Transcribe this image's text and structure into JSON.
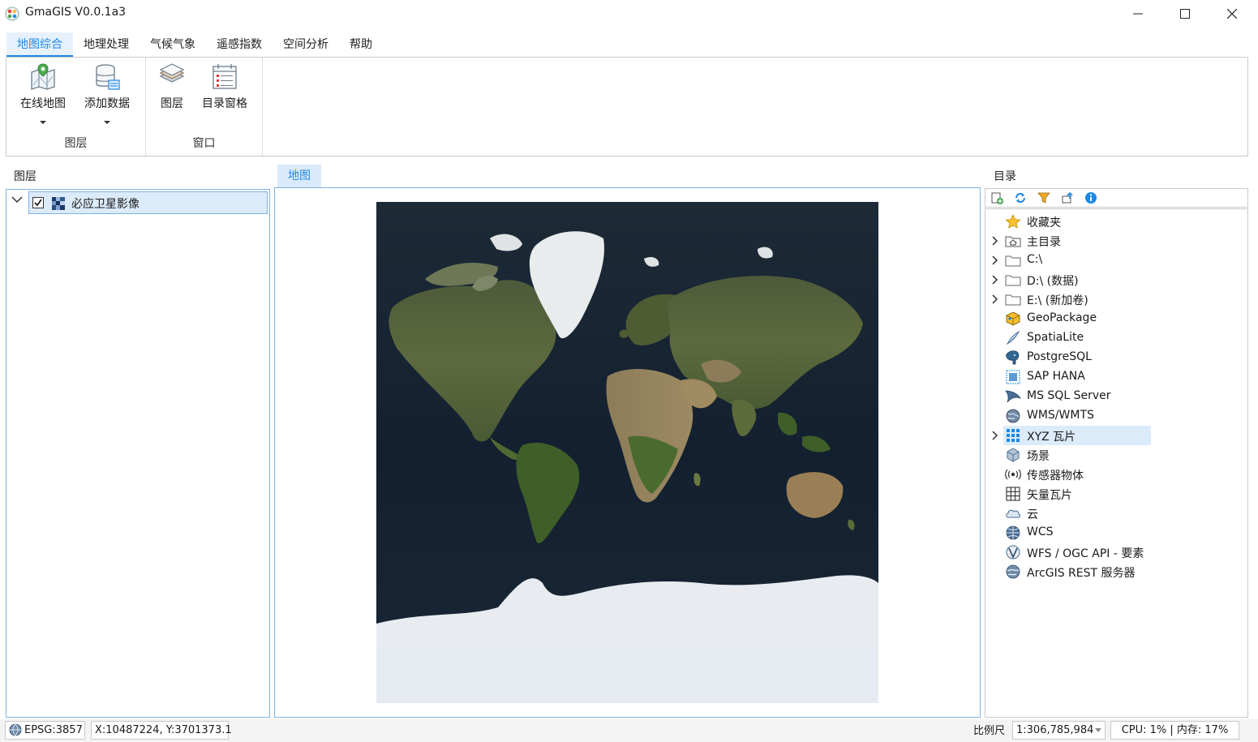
{
  "window": {
    "title": "GmaGIS V0.0.1a3",
    "controls": {
      "minimize": "minimize",
      "maximize": "maximize",
      "close": "close"
    }
  },
  "ribbon": {
    "tabs": [
      {
        "label": "地图综合",
        "active": true
      },
      {
        "label": "地理处理",
        "active": false
      },
      {
        "label": "气候气象",
        "active": false
      },
      {
        "label": "遥感指数",
        "active": false
      },
      {
        "label": "空间分析",
        "active": false
      },
      {
        "label": "帮助",
        "active": false
      }
    ],
    "groups": [
      {
        "label": "图层",
        "buttons": [
          {
            "label": "在线地图",
            "icon": "online-map-icon",
            "dropdown": true
          },
          {
            "label": "添加数据",
            "icon": "add-data-icon",
            "dropdown": true
          }
        ]
      },
      {
        "label": "窗口",
        "buttons": [
          {
            "label": "图层",
            "icon": "layers-icon",
            "dropdown": false
          },
          {
            "label": "目录窗格",
            "icon": "catalog-pane-icon",
            "dropdown": false
          }
        ]
      }
    ]
  },
  "layers_panel": {
    "title": "图层",
    "items": [
      {
        "name": "必应卫星影像",
        "checked": true,
        "expanded": true,
        "icon": "raster-layer-icon"
      }
    ]
  },
  "map": {
    "tab_label": "地图",
    "content": "world satellite imagery (Web Mercator)"
  },
  "catalog": {
    "title": "目录",
    "toolbar": [
      "add-icon",
      "refresh-icon",
      "filter-icon",
      "collapse-icon",
      "info-icon"
    ],
    "items": [
      {
        "label": "收藏夹",
        "icon": "star-icon",
        "expandable": false
      },
      {
        "label": "主目录",
        "icon": "home-folder-icon",
        "expandable": true
      },
      {
        "label": "C:\\",
        "icon": "folder-icon",
        "expandable": true
      },
      {
        "label": "D:\\ (数据)",
        "icon": "folder-icon",
        "expandable": true
      },
      {
        "label": "E:\\ (新加卷)",
        "icon": "folder-icon",
        "expandable": true
      },
      {
        "label": "GeoPackage",
        "icon": "geopackage-icon",
        "expandable": false
      },
      {
        "label": "SpatiaLite",
        "icon": "spatialite-icon",
        "expandable": false
      },
      {
        "label": "PostgreSQL",
        "icon": "postgresql-icon",
        "expandable": false
      },
      {
        "label": "SAP HANA",
        "icon": "sap-hana-icon",
        "expandable": false
      },
      {
        "label": "MS SQL Server",
        "icon": "mssql-icon",
        "expandable": false
      },
      {
        "label": "WMS/WMTS",
        "icon": "wms-icon",
        "expandable": false
      },
      {
        "label": "XYZ 瓦片",
        "icon": "xyz-tiles-icon",
        "expandable": true,
        "selected": true
      },
      {
        "label": "场景",
        "icon": "scene-icon",
        "expandable": false
      },
      {
        "label": "传感器物体",
        "icon": "sensor-icon",
        "expandable": false
      },
      {
        "label": "矢量瓦片",
        "icon": "vector-tiles-icon",
        "expandable": false
      },
      {
        "label": "云",
        "icon": "cloud-icon",
        "expandable": false
      },
      {
        "label": "WCS",
        "icon": "wcs-icon",
        "expandable": false
      },
      {
        "label": "WFS / OGC API - 要素",
        "icon": "wfs-icon",
        "expandable": false
      },
      {
        "label": "ArcGIS REST 服务器",
        "icon": "arcgis-rest-icon",
        "expandable": false
      }
    ]
  },
  "statusbar": {
    "crs": "EPSG:3857",
    "coordinates": "X:10487224, Y:3701373.1",
    "scale_label": "比例尺",
    "scale_value": "1:306,785,984",
    "system": "CPU:  1% | 内存: 17%"
  },
  "colors": {
    "accent": "#1e88e5",
    "selection": "#dcebfa",
    "panel_border": "#7fb2e0"
  }
}
